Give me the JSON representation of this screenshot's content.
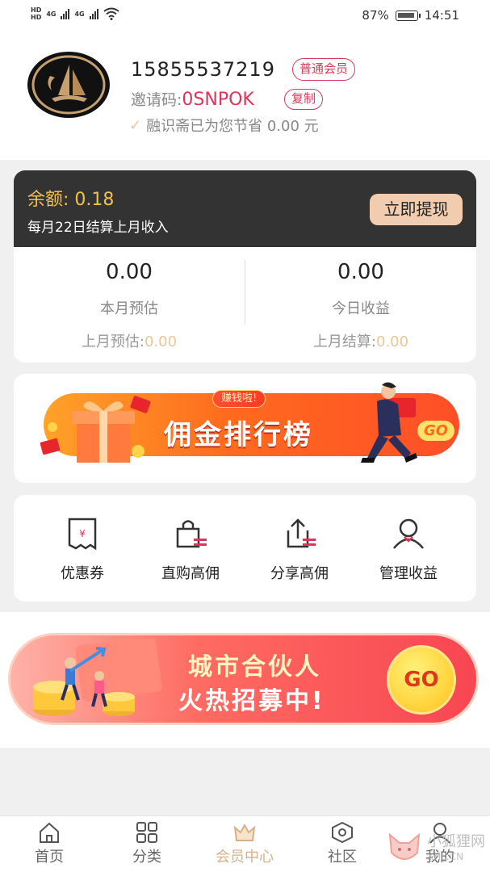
{
  "status_bar": {
    "hd1": "HD",
    "hd2": "HD",
    "net1": "4G",
    "net2": "4G",
    "battery": "87%",
    "time": "14:51"
  },
  "profile": {
    "phone": "15855537219",
    "member_badge": "普通会员",
    "invite_label": "邀请码:",
    "invite_code": "0SNPOK",
    "copy_button": "复制",
    "saved_text": "融识斋已为您节省 0.00 元"
  },
  "balance": {
    "label": "余额: 0.18",
    "note": "每月22日结算上月收入",
    "withdraw_button": "立即提现",
    "month_estimate_value": "0.00",
    "month_estimate_label": "本月预估",
    "last_month_estimate_label": "上月预估:",
    "last_month_estimate_value": "0.00",
    "today_income_value": "0.00",
    "today_income_label": "今日收益",
    "last_month_settle_label": "上月结算:",
    "last_month_settle_value": "0.00"
  },
  "rank_banner": {
    "tag": "赚钱啦!",
    "title": "佣金排行榜",
    "go": "GO"
  },
  "menu": {
    "items": [
      {
        "label": "优惠券",
        "icon": "coupon-icon"
      },
      {
        "label": "直购高佣",
        "icon": "shopping-bag-icon"
      },
      {
        "label": "分享高佣",
        "icon": "share-icon"
      },
      {
        "label": "管理收益",
        "icon": "user-icon"
      }
    ]
  },
  "partner_banner": {
    "line1": "城市合伙人",
    "line2": "火热招募中!",
    "go": "GO"
  },
  "nav": {
    "items": [
      {
        "label": "首页",
        "icon": "home-icon"
      },
      {
        "label": "分类",
        "icon": "grid-icon"
      },
      {
        "label": "会员中心",
        "icon": "crown-icon",
        "active": true
      },
      {
        "label": "社区",
        "icon": "community-icon"
      },
      {
        "label": "我的",
        "icon": "profile-icon"
      }
    ]
  },
  "watermark": {
    "text": "小狐狸网",
    "url": "XHL.CN"
  },
  "colors": {
    "accent_gold": "#f3c04a",
    "accent_pink": "#e3325a",
    "active_nav": "#d6b089"
  }
}
